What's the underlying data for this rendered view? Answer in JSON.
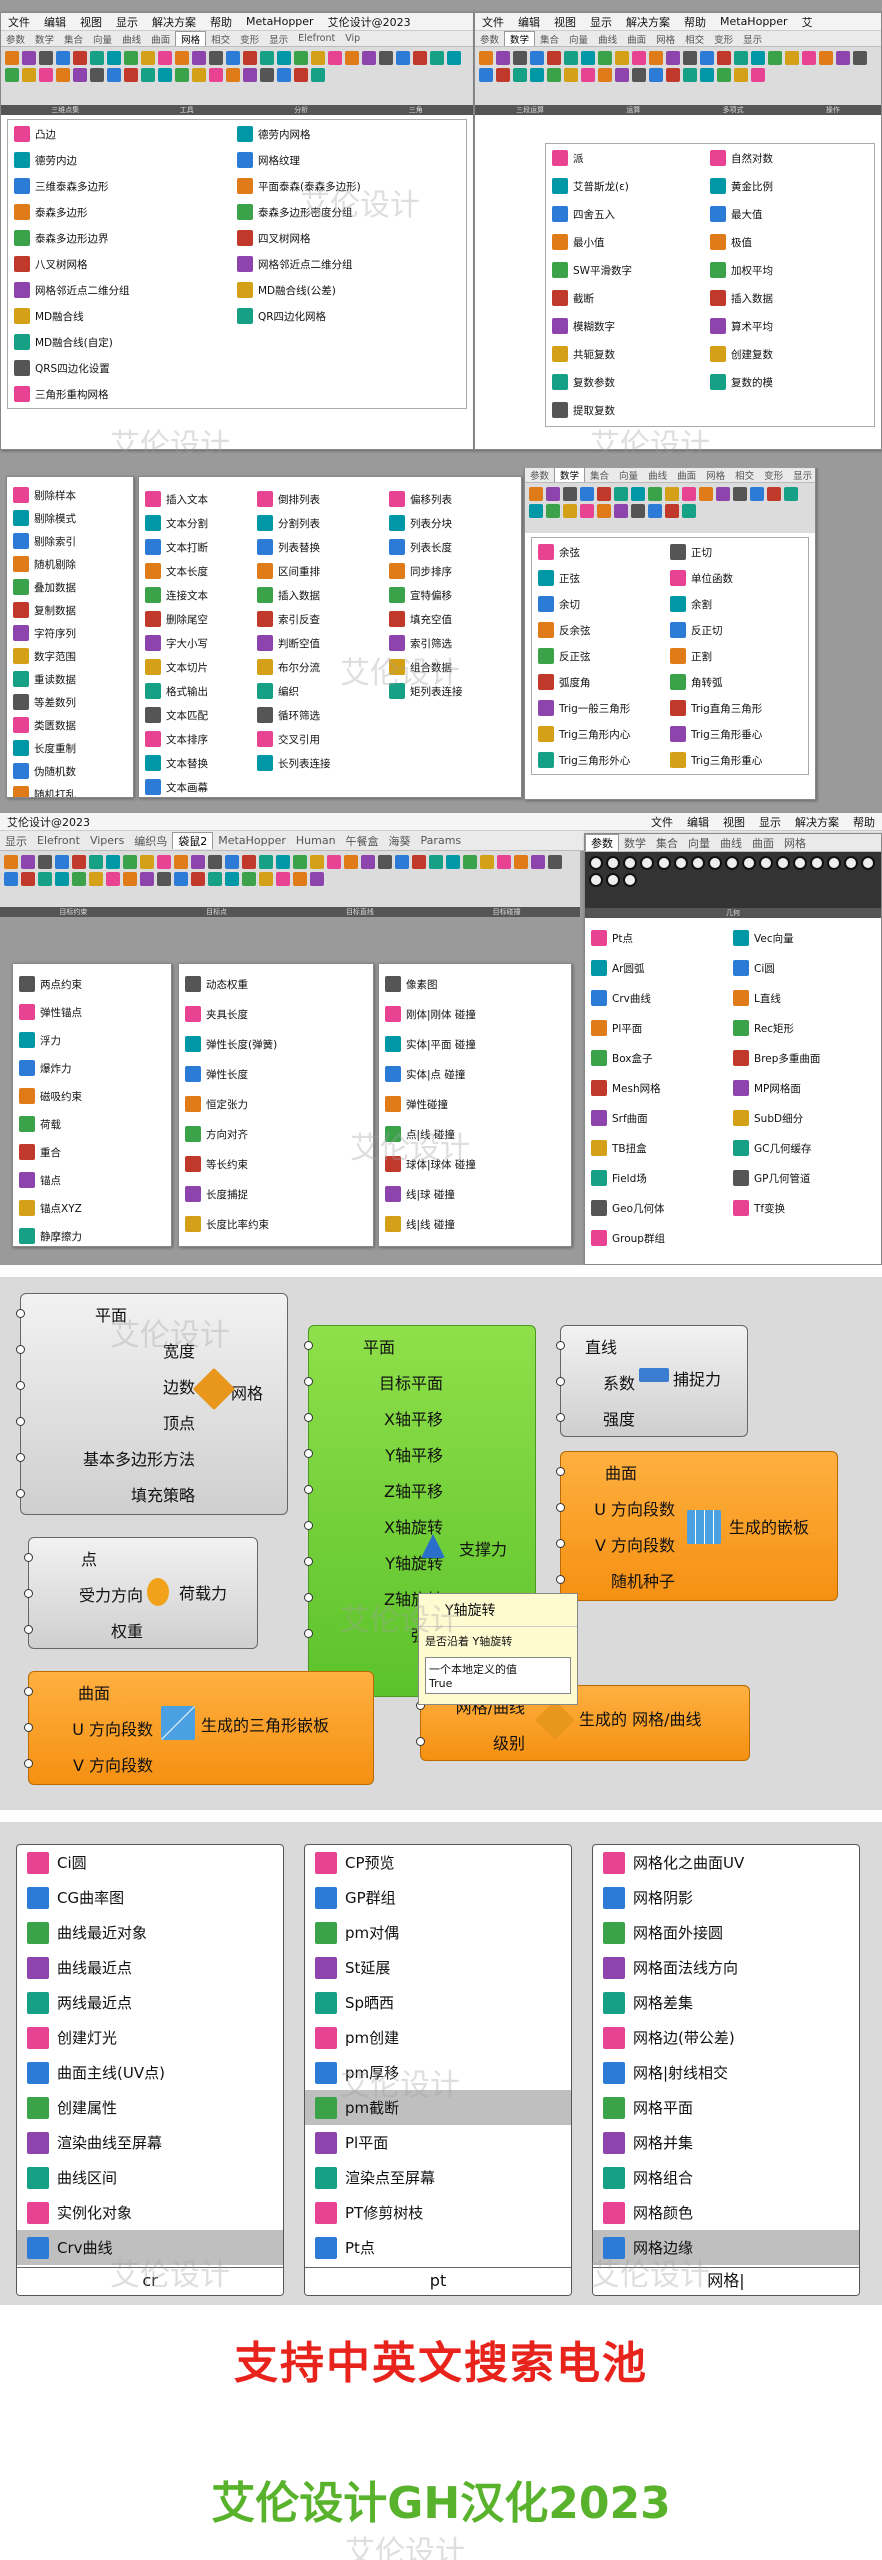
{
  "section1": {
    "panelA": {
      "menu": [
        "文件",
        "编辑",
        "视图",
        "显示",
        "解决方案",
        "帮助",
        "MetaHopper",
        "艾伦设计@2023"
      ],
      "tabs": [
        "参数",
        "数学",
        "集合",
        "向量",
        "曲线",
        "曲面",
        "网格",
        "相交",
        "变形",
        "显示",
        "Elefront",
        "Vip"
      ],
      "active_tab": "网格",
      "groups": [
        "三维点集",
        "工具",
        "分析",
        "三角"
      ],
      "items": [
        "凸边",
        "德劳内边",
        "三维泰森多边形",
        "泰森多边形",
        "泰森多边形边界",
        "八叉树网格",
        "网格邻近点二维分组",
        "MD融合线",
        "MD融合线(自定)",
        "QRS四边化设置",
        "三角形重构网格",
        "德劳内网格",
        "网格纹理",
        "平面泰森(泰森多边形)",
        "泰森多边形密度分组",
        "四叉树网格",
        "网格邻近点二维分组",
        "MD融合线(公差)",
        "QR四边化网格"
      ]
    },
    "panelB": {
      "menu": [
        "文件",
        "编辑",
        "视图",
        "显示",
        "解决方案",
        "帮助",
        "MetaHopper",
        "艾"
      ],
      "tabs": [
        "参数",
        "数学",
        "集合",
        "向量",
        "曲线",
        "曲面",
        "网格",
        "相交",
        "变形",
        "显示"
      ],
      "active_tab": "数学",
      "groups": [
        "三段运算",
        "运算",
        "多项式",
        "操作"
      ],
      "items": [
        "派",
        "艾普斯龙(ε)",
        "四舍五入",
        "最小值",
        "SW平滑数字",
        "截断",
        "模糊数字",
        "共轭复数",
        "复数参数",
        "提取复数",
        "自然对数",
        "黄金比例",
        "最大值",
        "极值",
        "加权平均",
        "插入数据",
        "算术平均",
        "创建复数",
        "复数的模"
      ]
    }
  },
  "section2": {
    "panelC": {
      "items": [
        "剔除样本",
        "剔除模式",
        "剔除索引",
        "随机剔除",
        "叠加数据",
        "复制数据",
        "字符序列",
        "数字范围",
        "重读数据",
        "等差数列",
        "类匮数据",
        "长度重制",
        "伪随机数",
        "随机打乱"
      ]
    },
    "panelD": {
      "col1": [
        "插入文本",
        "文本分割",
        "文本打断",
        "文本长度",
        "连接文本",
        "删除尾空",
        "字大小写",
        "文本切片",
        "格式输出",
        "文本匹配",
        "文本排序",
        "文本替换",
        "文本画幕"
      ],
      "col2": [
        "倒排列表",
        "分割列表",
        "列表替换",
        "区间重排",
        "插入数据",
        "索引反查",
        "判断空值",
        "布尔分流",
        "编织",
        "循环筛选",
        "交叉引用",
        "长列表连接"
      ],
      "col3": [
        "偏移列表",
        "列表分块",
        "列表长度",
        "同步排序",
        "宣特偏移",
        "填充空值",
        "索引筛选",
        "组合数据",
        "矩列表连接"
      ]
    },
    "panelE": {
      "menu": [
        "文件",
        "编辑",
        "视图",
        "显示",
        "解决方案",
        "帮助",
        "MetaHop"
      ],
      "tabs": [
        "参数",
        "数学",
        "集合",
        "向量",
        "曲线",
        "曲面",
        "网格",
        "相交",
        "变形",
        "显示"
      ],
      "active_tab": "数学",
      "items": [
        "余弦",
        "正弦",
        "余切",
        "反余弦",
        "反正弦",
        "弧度角",
        "Trig一般三角形",
        "Trig三角形内心",
        "Trig三角形外心",
        "正切",
        "单位函数",
        "余割",
        "反正切",
        "正割",
        "角转弧",
        "Trig直角三角形",
        "Trig三角形垂心",
        "Trig三角形重心"
      ]
    }
  },
  "section3": {
    "menu": [
      "文件",
      "编辑",
      "视图",
      "显示",
      "解决方案",
      "帮助"
    ],
    "title": "艾伦设计@2023",
    "tabs": [
      "显示",
      "Elefront",
      "Vipers",
      "编织鸟",
      "袋鼠2",
      "MetaHopper",
      "Human",
      "午餐盒",
      "海葵",
      "Params"
    ],
    "active_tab": "袋鼠2",
    "groups": [
      "目标约束",
      "目标点",
      "目标直线",
      "目标碰撞"
    ],
    "col1": [
      "两点约束",
      "弹性锚点",
      "浮力",
      "爆炸力",
      "磁吸约束",
      "荷载",
      "重合",
      "锚点",
      "锚点XYZ",
      "静摩擦力"
    ],
    "col2": [
      "动态权重",
      "夹具长度",
      "弹性长度(弹簧)",
      "弹性长度",
      "恒定张力",
      "方向对齐",
      "等长约束",
      "长度捕捉",
      "长度比率约束"
    ],
    "col3": [
      "像素图",
      "刚体|刚体 碰撞",
      "实体|平面 碰撞",
      "实体|点 碰撞",
      "弹性碰撞",
      "点|线 碰撞",
      "球体|球体 碰撞",
      "线|球 碰撞",
      "线|线 碰撞"
    ],
    "right": {
      "tabs": [
        "参数",
        "数学",
        "集合",
        "向量",
        "曲线",
        "曲面",
        "网格"
      ],
      "active_tab": "参数",
      "group": "几何",
      "items": [
        "Pt点",
        "Ar圆弧",
        "Crv曲线",
        "Pl平面",
        "Box盒子",
        "Mesh网格",
        "Srf曲面",
        "TB扭盒",
        "Field场",
        "Geo几何体",
        "Group群组",
        "Vec向量",
        "Ci圆",
        "L直线",
        "Rec矩形",
        "Brep多重曲面",
        "MP网格面",
        "SubD细分",
        "GC几何缓存",
        "GP几何管道",
        "Tf变换"
      ]
    }
  },
  "section4": {
    "comp1": {
      "inputs": [
        "平面",
        "宽度",
        "边数",
        "顶点",
        "基本多边形方法",
        "填充策略"
      ],
      "output": "网格"
    },
    "comp2": {
      "inputs": [
        "平面",
        "目标平面",
        "X轴平移",
        "Y轴平移",
        "Z轴平移",
        "X轴旋转",
        "Y轴旋转",
        "Z轴旋转",
        "强度"
      ],
      "output": "支撑力"
    },
    "comp3": {
      "inputs": [
        "直线",
        "系数",
        "强度"
      ],
      "output": "捕捉力"
    },
    "comp4": {
      "inputs": [
        "曲面",
        "U 方向段数",
        "V 方向段数",
        "随机种子"
      ],
      "output": "生成的嵌板"
    },
    "comp5": {
      "inputs": [
        "点",
        "受力方向",
        "权重"
      ],
      "output": "荷载力"
    },
    "comp6": {
      "inputs": [
        "曲面",
        "U 方向段数",
        "V 方向段数"
      ],
      "output": "生成的三角形嵌板"
    },
    "comp7": {
      "inputs": [
        "网格/曲线",
        "级别"
      ],
      "output": "生成的 网格/曲线"
    },
    "tooltip": {
      "title": "Y轴旋转",
      "line1": "是否沿着 Y轴旋转",
      "line2": "一个本地定义的值",
      "value": "True"
    }
  },
  "section5": {
    "box1": {
      "items": [
        "Ci圆",
        "CG曲率图",
        "曲线最近对象",
        "曲线最近点",
        "两线最近点",
        "创建灯光",
        "曲面主线(UV点)",
        "创建属性",
        "渲染曲线至屏幕",
        "曲线区间",
        "实例化对象",
        "Crv曲线"
      ],
      "query": "cr"
    },
    "box2": {
      "items": [
        "CP预览",
        "GP群组",
        "pm对偶",
        "St延展",
        "Sp晒西",
        "pm创建",
        "pm厚移",
        "pm截断",
        "Pl平面",
        "渲染点至屏幕",
        "PT修剪树枝",
        "Pt点"
      ],
      "query": "pt"
    },
    "box3": {
      "items": [
        "网格化之曲面UV",
        "网格阴影",
        "网格面外接圆",
        "网格面法线方向",
        "网格差集",
        "网格边(带公差)",
        "网格|射线相交",
        "网格平面",
        "网格并集",
        "网格组合",
        "网格颜色",
        "网格边缘"
      ],
      "query": "网格|"
    }
  },
  "footer": {
    "banner": "支持中英文搜索电池",
    "title": "艾伦设计GH汉化2023"
  },
  "watermark": "艾伦设计",
  "colors": {
    "red": "#e8231b",
    "green": "#58b22b",
    "orange": "#f59012",
    "comp_green": "#7cd43a"
  }
}
